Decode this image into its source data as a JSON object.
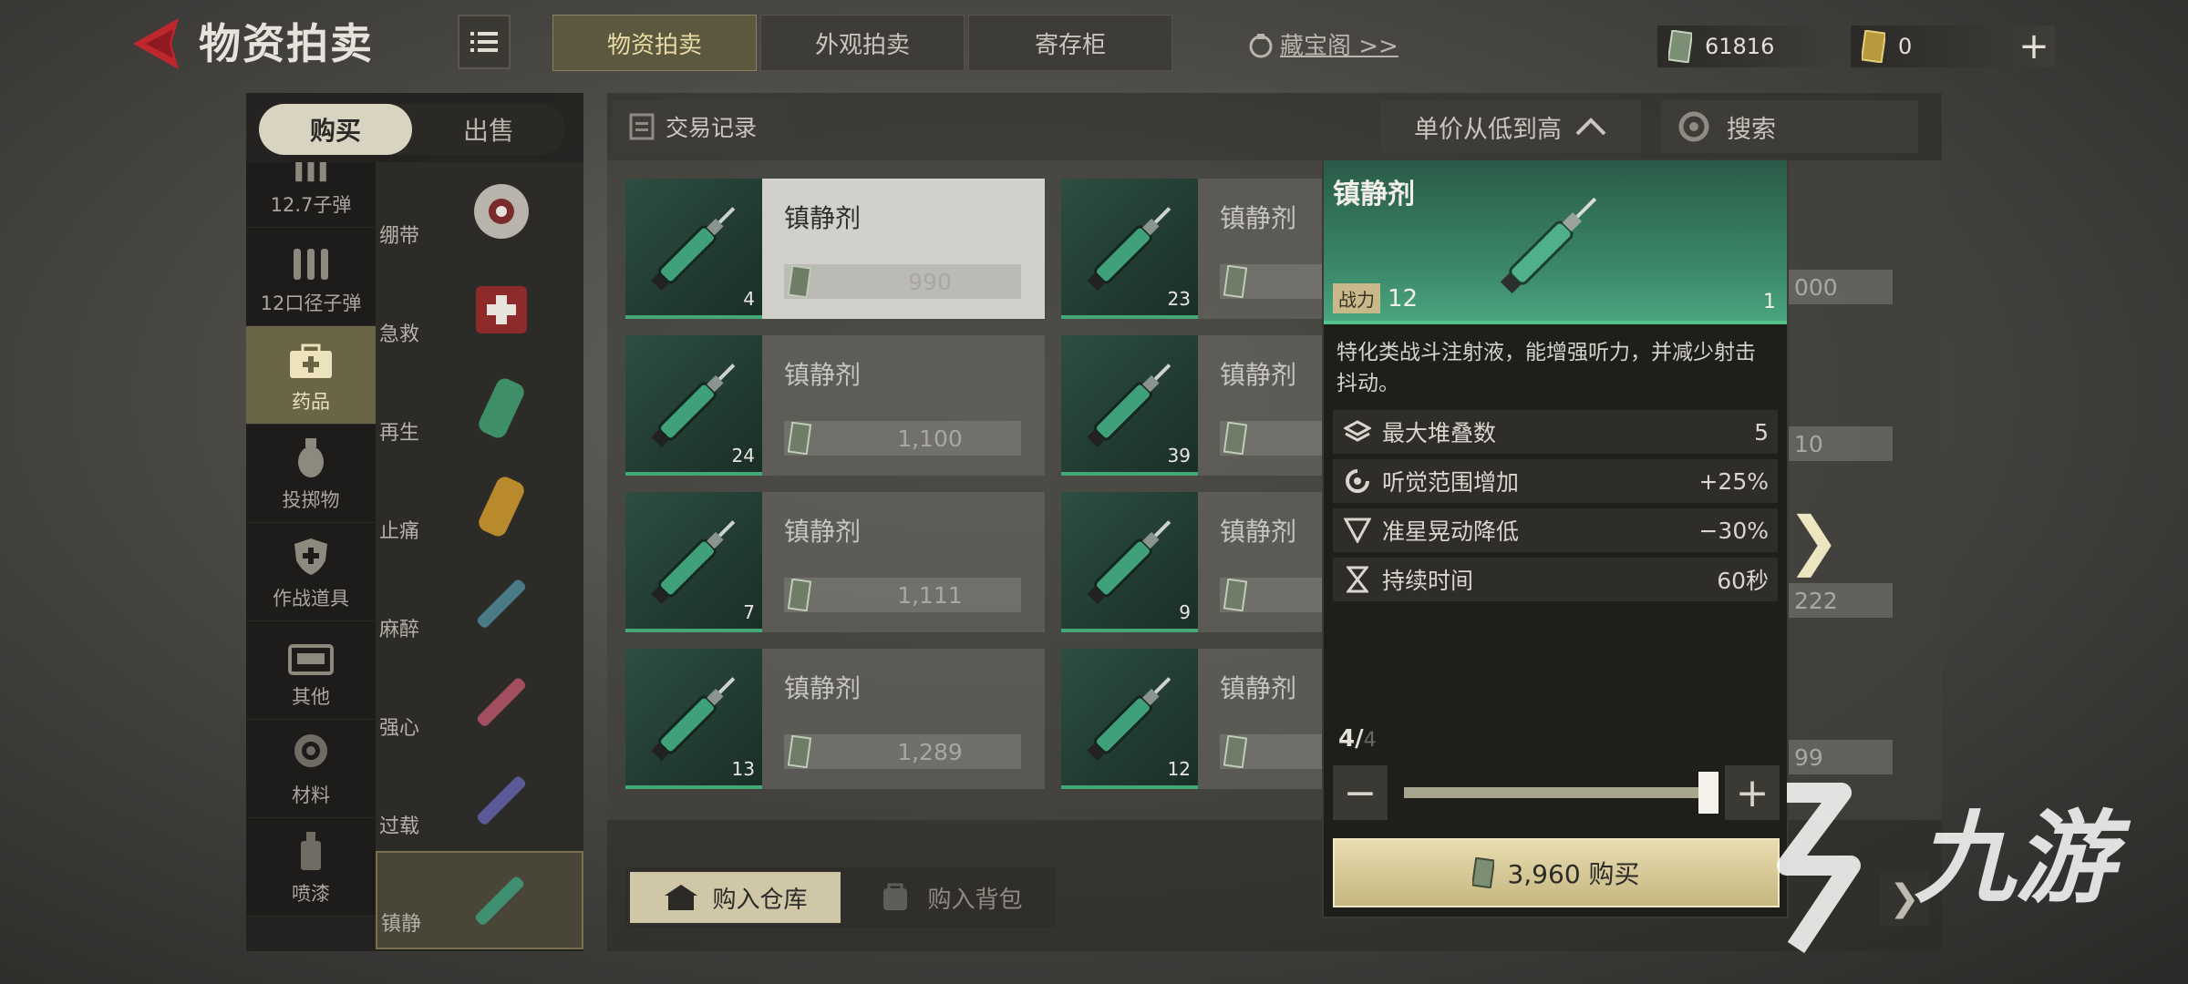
{
  "header": {
    "title": "物资拍卖",
    "tabs": [
      {
        "label": "物资拍卖",
        "active": true
      },
      {
        "label": "外观拍卖",
        "active": false
      },
      {
        "label": "寄存柜",
        "active": false
      }
    ],
    "treasure_link": "藏宝阁 >>",
    "currency_cash": "61816",
    "currency_gold": "0"
  },
  "left": {
    "mode_tabs": [
      {
        "label": "购买",
        "active": true
      },
      {
        "label": "出售",
        "active": false
      }
    ],
    "categories": [
      {
        "label": "12.7子弹",
        "icon": "bullets-icon"
      },
      {
        "label": "12口径子弹",
        "icon": "shotgun-shells-icon"
      },
      {
        "label": "药品",
        "icon": "medkit-icon",
        "active": true
      },
      {
        "label": "投掷物",
        "icon": "grenade-icon"
      },
      {
        "label": "作战道具",
        "icon": "shield-icon"
      },
      {
        "label": "其他",
        "icon": "box-icon"
      },
      {
        "label": "材料",
        "icon": "gear-icon"
      },
      {
        "label": "喷漆",
        "icon": "spray-can-icon"
      }
    ],
    "subcategories": [
      {
        "label": "绷带",
        "icon": "bandage-icon"
      },
      {
        "label": "急救",
        "icon": "first-aid-kit-icon"
      },
      {
        "label": "再生",
        "icon": "regen-canister-icon"
      },
      {
        "label": "止痛",
        "icon": "painkiller-canister-icon"
      },
      {
        "label": "麻醉",
        "icon": "anesthetic-syringe-icon"
      },
      {
        "label": "强心",
        "icon": "adrenaline-syringe-icon"
      },
      {
        "label": "过载",
        "icon": "overload-syringe-icon"
      },
      {
        "label": "镇静",
        "icon": "sedative-syringe-icon",
        "active": true
      }
    ]
  },
  "toolbar": {
    "history_label": "交易记录",
    "sort_label": "单价从低到高",
    "search_placeholder": "搜索"
  },
  "listings": {
    "left_column": [
      {
        "name": "镇静剂",
        "count": "4",
        "price": "990",
        "selected": true
      },
      {
        "name": "镇静剂",
        "count": "24",
        "price": "1,100"
      },
      {
        "name": "镇静剂",
        "count": "7",
        "price": "1,111"
      },
      {
        "name": "镇静剂",
        "count": "13",
        "price": "1,289"
      }
    ],
    "right_column": [
      {
        "name": "镇静剂",
        "count": "23",
        "price": ""
      },
      {
        "name": "镇静剂",
        "count": "39",
        "price": ""
      },
      {
        "name": "镇静剂",
        "count": "9",
        "price": ""
      },
      {
        "name": "镇静剂",
        "count": "12",
        "price": ""
      }
    ],
    "third_column_partial_prices": [
      "000",
      "10",
      "222",
      "99"
    ]
  },
  "buy_targets": [
    {
      "label": "购入仓库",
      "active": true
    },
    {
      "label": "购入背包",
      "active": false
    }
  ],
  "detail": {
    "title": "镇静剂",
    "power_label": "战力",
    "power_value": "12",
    "quantity_badge": "1",
    "description": "特化类战斗注射液，能增强听力，并减少射击抖动。",
    "stats": [
      {
        "label": "最大堆叠数",
        "value": "5",
        "icon": "stack-icon"
      },
      {
        "label": "听觉范围增加",
        "value": "+25%",
        "icon": "hearing-icon"
      },
      {
        "label": "准星晃动降低",
        "value": "−30%",
        "icon": "crosshair-icon"
      },
      {
        "label": "持续时间",
        "value": "60秒",
        "icon": "hourglass-icon"
      }
    ],
    "qty_selected": "4/",
    "qty_max": "4",
    "slider_fraction": 1.0,
    "buy_label": "3,960 购买"
  },
  "watermark_text": "九游",
  "colors": {
    "accent_gold": "#cfc7a8",
    "rarity_green": "#43a876",
    "back_red": "#c0272d"
  }
}
